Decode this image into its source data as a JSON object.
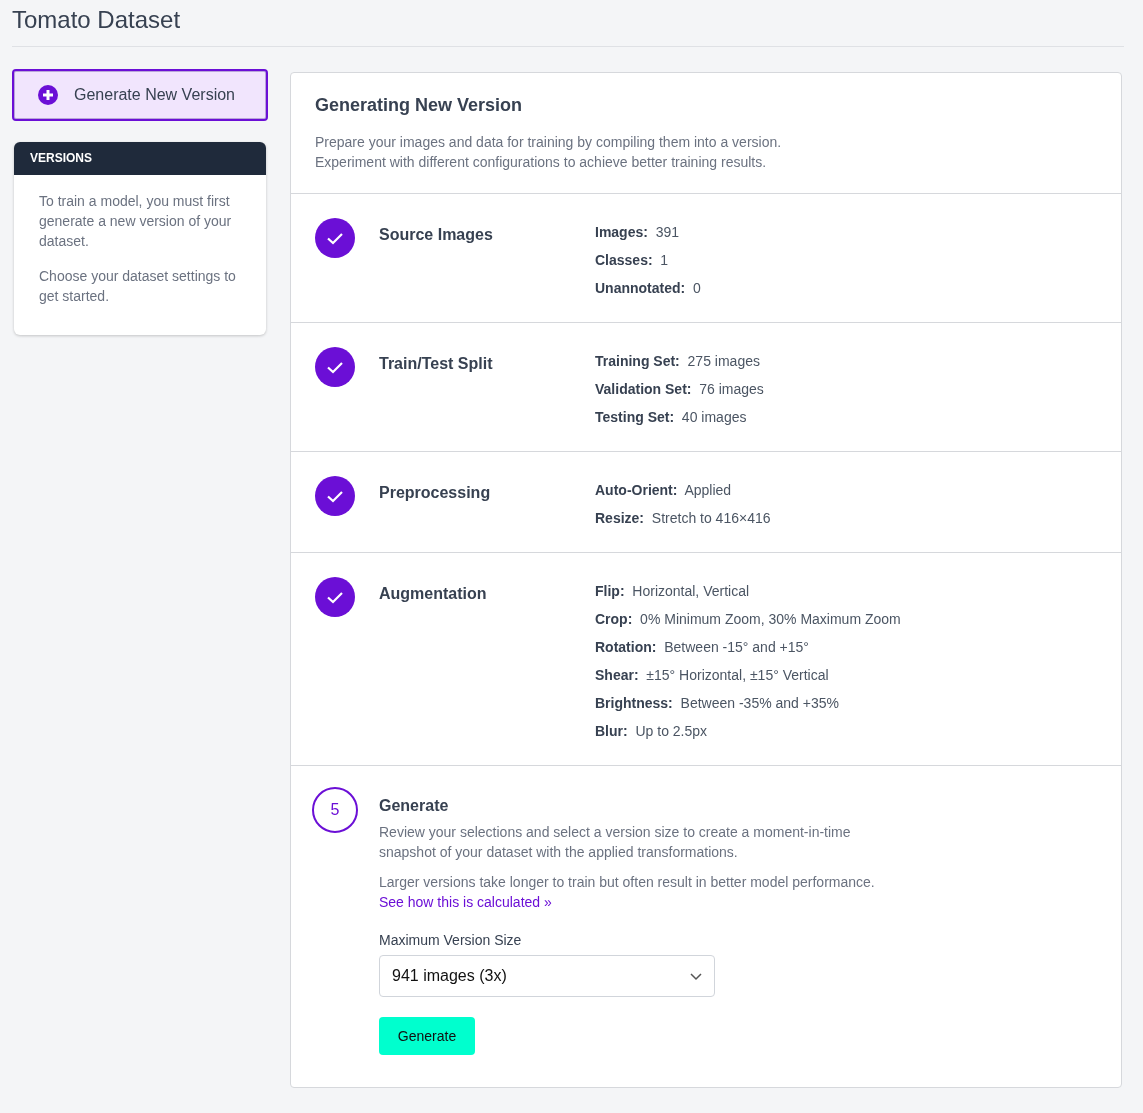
{
  "page": {
    "title": "Tomato Dataset"
  },
  "sidebar": {
    "generate_button": "Generate New Version",
    "versions_panel": {
      "heading": "VERSIONS",
      "paragraphs": [
        "To train a model, you must first generate a new version of your dataset.",
        "Choose your dataset settings to get started."
      ]
    }
  },
  "main": {
    "title": "Generating New Version",
    "description": "Prepare your images and data for training by compiling them into a version. Experiment with different configurations to achieve better training results.",
    "steps": [
      {
        "kind": "complete",
        "title": "Source Images",
        "details": [
          {
            "label": "Images:",
            "value": "391"
          },
          {
            "label": "Classes:",
            "value": "1"
          },
          {
            "label": "Unannotated:",
            "value": "0"
          }
        ]
      },
      {
        "kind": "complete",
        "title": "Train/Test Split",
        "details": [
          {
            "label": "Training Set:",
            "value": "275 images"
          },
          {
            "label": "Validation Set:",
            "value": "76 images"
          },
          {
            "label": "Testing Set:",
            "value": "40 images"
          }
        ]
      },
      {
        "kind": "complete",
        "title": "Preprocessing",
        "details": [
          {
            "label": "Auto-Orient:",
            "value": "Applied"
          },
          {
            "label": "Resize:",
            "value": "Stretch to 416×416"
          }
        ]
      },
      {
        "kind": "complete",
        "title": "Augmentation",
        "details": [
          {
            "label": "Flip:",
            "value": "Horizontal, Vertical"
          },
          {
            "label": "Crop:",
            "value": "0% Minimum Zoom, 30% Maximum Zoom"
          },
          {
            "label": "Rotation:",
            "value": "Between -15° and +15°"
          },
          {
            "label": "Shear:",
            "value": "±15° Horizontal, ±15° Vertical"
          },
          {
            "label": "Brightness:",
            "value": "Between -35% and +35%"
          },
          {
            "label": "Blur:",
            "value": "Up to 2.5px"
          }
        ]
      },
      {
        "kind": "numbered",
        "number": "5",
        "title": "Generate",
        "paragraphs": [
          "Review your selections and select a version size to create a moment-in-time snapshot of your dataset with the applied transformations.",
          "Larger versions take longer to train but often result in better model performance."
        ],
        "link": "See how this is calculated »",
        "size_label": "Maximum Version Size",
        "size_value": "941 images (3x)",
        "button": "Generate"
      }
    ]
  }
}
